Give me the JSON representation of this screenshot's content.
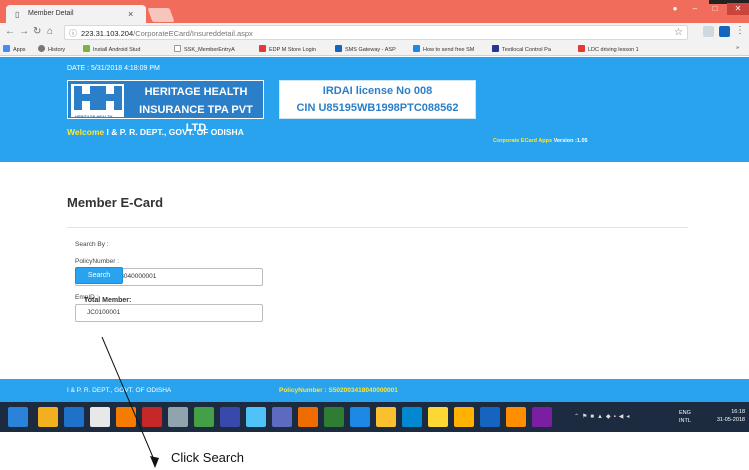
{
  "browser": {
    "tab_title": "Member Detail",
    "tab_close": "×",
    "url_host": "223.31.103.204",
    "url_path": "/CorporateECard/Insureddetail.aspx",
    "bookmarks": [
      {
        "label": "Apps",
        "color": "#4a8af4"
      },
      {
        "label": "History",
        "color": "#777777"
      },
      {
        "label": "Install Android Stud",
        "color": "#7cb342"
      },
      {
        "label": "SSK_MemberEntryA",
        "color": "#999999"
      },
      {
        "label": "EDP M Store Login",
        "color": "#e53935"
      },
      {
        "label": "SMS Gateway - ASP",
        "color": "#1565c0"
      },
      {
        "label": "How to send free SM",
        "color": "#1e88e5"
      },
      {
        "label": "Textlocal Control Pa",
        "color": "#283593"
      },
      {
        "label": "LDC driving lesson 1",
        "color": "#e53935"
      }
    ]
  },
  "header": {
    "date": "DATE : 5/31/2018 4:18:09 PM",
    "company_line1": "HERITAGE HEALTH",
    "company_line2": "INSURANCE TPA PVT LTD",
    "logo_small_text": "HERITAGE HEALTH",
    "irdai": "IRDAI license No 008",
    "cin": "CIN U85195WB1998PTC088562",
    "welcome_label": "Welcome",
    "welcome_name": "I & P. R. DEPT., GOVT. OF ODISHA",
    "version_label": "Corporate ECard Apps",
    "version_value": "Version :1.05"
  },
  "main": {
    "title": "Member E-Card",
    "search_by": "Search By :",
    "policy_label": "PolicyNumber :",
    "policy_value": "S502003418040000001",
    "emp_label": "EmpID :",
    "emp_value": "JC0100001",
    "search_button": "Search",
    "total_member": "Total Member:"
  },
  "footer": {
    "org": "I & P. R. DEPT., GOVT. OF ODISHA",
    "policy": "PolicyNumber : S502003418040000001"
  },
  "taskbar": {
    "lang1": "ENG",
    "lang2": "INTL",
    "time": "16:18",
    "date": "31-05-2018"
  },
  "annotation": {
    "text": "Click Search"
  },
  "colors": {
    "header_blue": "#2aa3ee",
    "brand_blue": "#2a7fc8",
    "welcome_yellow": "#ffe633",
    "tab_strip": "#f26c5c",
    "taskbar": "#1c2b3f"
  }
}
